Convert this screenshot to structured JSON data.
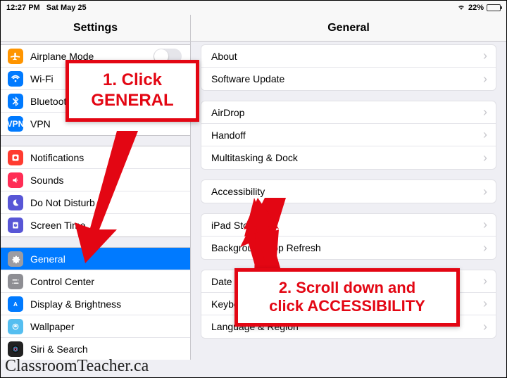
{
  "statusbar": {
    "time": "12:27 PM",
    "date": "Sat May 25",
    "battery_pct": "22%"
  },
  "sidebar": {
    "title": "Settings",
    "g1": [
      {
        "label": "Airplane Mode"
      },
      {
        "label": "Wi-Fi"
      },
      {
        "label": "Bluetooth"
      },
      {
        "label": "VPN"
      }
    ],
    "g2": [
      {
        "label": "Notifications"
      },
      {
        "label": "Sounds"
      },
      {
        "label": "Do Not Disturb"
      },
      {
        "label": "Screen Time"
      }
    ],
    "g3": [
      {
        "label": "General"
      },
      {
        "label": "Control Center"
      },
      {
        "label": "Display & Brightness"
      },
      {
        "label": "Wallpaper"
      },
      {
        "label": "Siri & Search"
      }
    ]
  },
  "main": {
    "title": "General",
    "g1": [
      {
        "label": "About"
      },
      {
        "label": "Software Update"
      }
    ],
    "g2": [
      {
        "label": "AirDrop"
      },
      {
        "label": "Handoff"
      },
      {
        "label": "Multitasking & Dock"
      }
    ],
    "g3": [
      {
        "label": "Accessibility"
      }
    ],
    "g4": [
      {
        "label": "iPad Storage"
      },
      {
        "label": "Background App Refresh"
      }
    ],
    "g5": [
      {
        "label": "Date & Time"
      },
      {
        "label": "Keyboard"
      },
      {
        "label": "Language & Region"
      }
    ]
  },
  "annotations": {
    "callout1_line1": "1. Click",
    "callout1_line2": "GENERAL",
    "callout2_line1": "2. Scroll down and",
    "callout2_line2": "click ACCESSIBILITY"
  },
  "watermark": "ClassroomTeacher.ca"
}
